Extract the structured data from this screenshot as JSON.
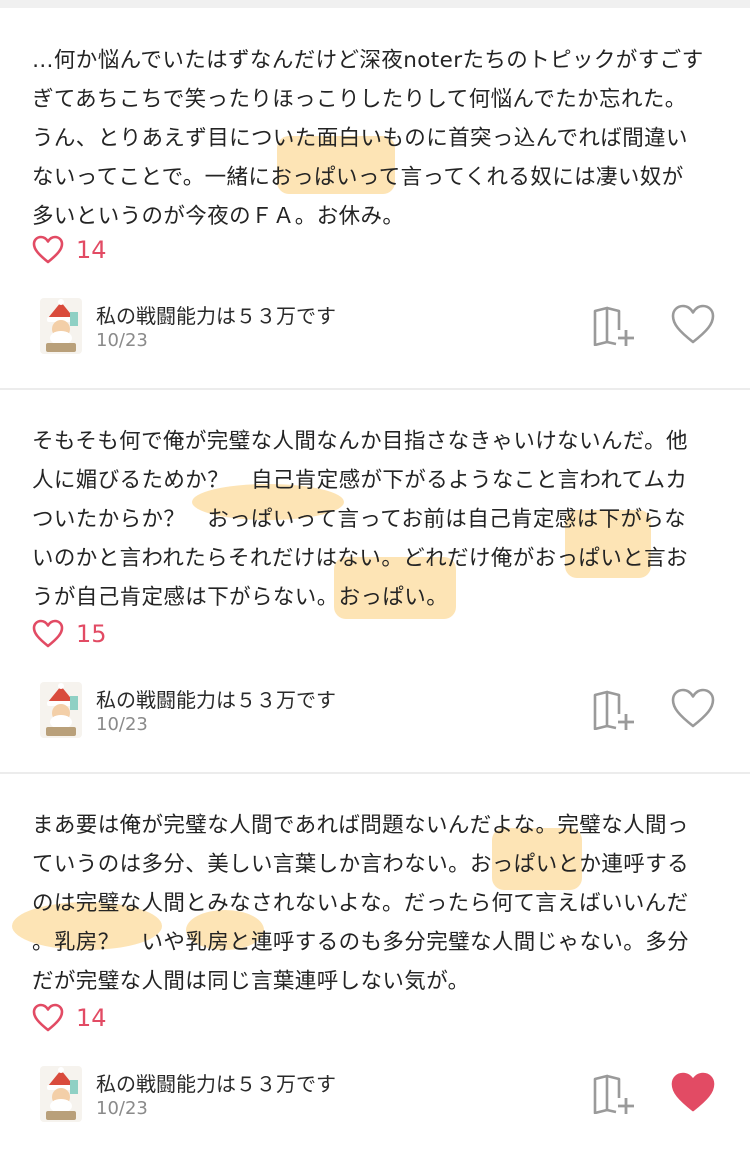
{
  "posts": [
    {
      "lines": [
        "…何か悩んでいたはずなんだけど深夜noterたちのトピックがすごす",
        "ぎてあちこちで笑ったりほっこりしたりして何悩んでたか忘れた。",
        "うん、とりあえず目についた面白いものに首突っ込んでれば間違い",
        "ないってことで。一緒におっぱいって言ってくれる奴には凄い奴が",
        "多いというのが今夜のＦＡ。お休み。"
      ],
      "likes": "14",
      "author": "私の戦闘能力は５３万です",
      "date": "10/23",
      "liked": false
    },
    {
      "lines": [
        "そもそも何で俺が完璧な人間なんか目指さなきゃいけないんだ。他",
        "人に媚びるためか？　自己肯定感が下がるようなこと言われてムカ",
        "ついたからか？　おっぱいって言ってお前は自己肯定感は下がらな",
        "いのかと言われたらそれだけはない。どれだけ俺がおっぱいと言お",
        "うが自己肯定感は下がらない。おっぱい。"
      ],
      "likes": "15",
      "author": "私の戦闘能力は５３万です",
      "date": "10/23",
      "liked": false
    },
    {
      "lines": [
        "まあ要は俺が完璧な人間であれば問題ないんだよな。完璧な人間っ",
        "ていうのは多分、美しい言葉しか言わない。おっぱいとか連呼する",
        "のは完璧な人間とみなされないよな。だったら何て言えばいいんだ",
        "。乳房？　いや乳房と連呼するのも多分完璧な人間じゃない。多分",
        "だが完璧な人間は同じ言葉連呼しない気が。"
      ],
      "likes": "14",
      "author": "私の戦闘能力は５３万です",
      "date": "10/23",
      "liked": true
    }
  ],
  "icons": {
    "like": "heart-outline-icon",
    "magazine": "magazine-add-icon",
    "heart_empty": "heart-outline-icon",
    "heart_filled": "heart-filled-icon"
  },
  "colors": {
    "accent": "#e24b64",
    "highlight": "#fcd7a0",
    "divider": "#ececec"
  }
}
